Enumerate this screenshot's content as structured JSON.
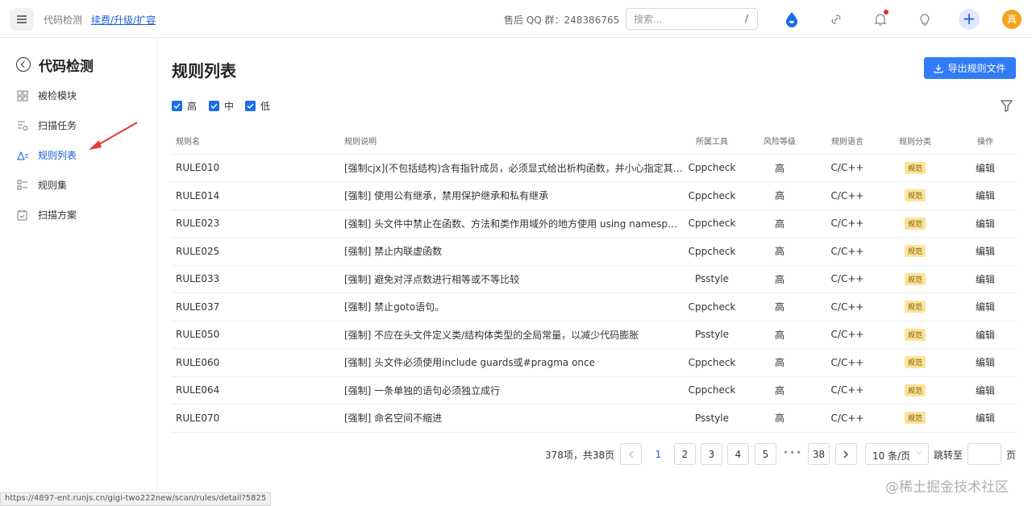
{
  "topbar": {
    "app_title": "代码检测",
    "renew_link": "续费/升级/扩容",
    "qq_group": "售后 QQ 群：248386765",
    "search_placeholder": "搜索...",
    "search_shortcut": "/",
    "avatar_text": "真"
  },
  "sidebar": {
    "title": "代码检测",
    "items": [
      {
        "label": "被检模块",
        "icon": "grid-icon"
      },
      {
        "label": "扫描任务",
        "icon": "task-list-icon"
      },
      {
        "label": "规则列表",
        "icon": "rules-list-icon",
        "active": true
      },
      {
        "label": "规则集",
        "icon": "rule-set-icon"
      },
      {
        "label": "扫描方案",
        "icon": "scan-plan-icon"
      }
    ]
  },
  "main": {
    "title": "规则列表",
    "export_label": "导出规则文件",
    "filters": [
      {
        "label": "高",
        "checked": true
      },
      {
        "label": "中",
        "checked": true
      },
      {
        "label": "低",
        "checked": true
      }
    ]
  },
  "table": {
    "headers": [
      "规则名",
      "规则说明",
      "所属工具",
      "风险等级",
      "规则语言",
      "规则分类",
      "操作"
    ],
    "rows": [
      [
        "RULE010",
        "[强制cjx](不包括结构)含有指针成员，必须显式给出析构函数，并小心指定其拷贝构造函数和赋值运算符",
        "Cppcheck",
        "高",
        "C/C++",
        "规范",
        "编辑"
      ],
      [
        "RULE014",
        "[强制] 使用公有继承，禁用保护继承和私有继承",
        "Cppcheck",
        "高",
        "C/C++",
        "规范",
        "编辑"
      ],
      [
        "RULE023",
        "[强制] 头文件中禁止在函数、方法和类作用域外的地方使用 using namespace 指令",
        "Cppcheck",
        "高",
        "C/C++",
        "规范",
        "编辑"
      ],
      [
        "RULE025",
        "[强制] 禁止内联虚函数",
        "Cppcheck",
        "高",
        "C/C++",
        "规范",
        "编辑"
      ],
      [
        "RULE033",
        "[强制] 避免对浮点数进行相等或不等比较",
        "Psstyle",
        "高",
        "C/C++",
        "规范",
        "编辑"
      ],
      [
        "RULE037",
        "[强制] 禁止goto语句。",
        "Cppcheck",
        "高",
        "C/C++",
        "规范",
        "编辑"
      ],
      [
        "RULE050",
        "[强制] 不应在头文件定义类/结构体类型的全局常量，以减少代码膨胀",
        "Psstyle",
        "高",
        "C/C++",
        "规范",
        "编辑"
      ],
      [
        "RULE060",
        "[强制] 头文件必须使用include guards或#pragma once",
        "Cppcheck",
        "高",
        "C/C++",
        "规范",
        "编辑"
      ],
      [
        "RULE064",
        "[强制] 一条单独的语句必须独立成行",
        "Cppcheck",
        "高",
        "C/C++",
        "规范",
        "编辑"
      ],
      [
        "RULE070",
        "[强制] 命名空间不缩进",
        "Psstyle",
        "高",
        "C/C++",
        "规范",
        "编辑"
      ]
    ]
  },
  "pagination": {
    "total_text": "378项，共38页",
    "pages": [
      "1",
      "2",
      "3",
      "4",
      "5"
    ],
    "ellipsis": "•••",
    "last_page": "38",
    "current_page": "1",
    "page_size": "10 条/页",
    "jump_label": "跳转至",
    "page_label": "页"
  },
  "status_bar": {
    "url": "https://4897-ent.runjs.cn/gigi-two222new/scan/rules/detail?5825"
  },
  "watermark": "@稀土掘金技术社区",
  "colors": {
    "accent": "#1a5bd6",
    "button": "#2f7cf6",
    "tag_bg": "#fde39a",
    "arrow": "#e53935"
  }
}
